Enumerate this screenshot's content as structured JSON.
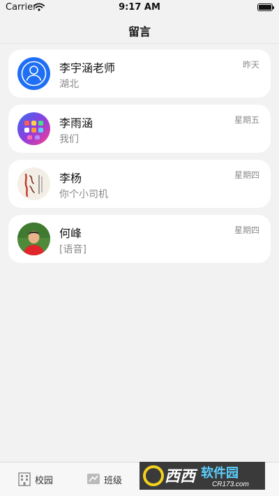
{
  "status": {
    "carrier": "Carrier",
    "time": "9:17 AM"
  },
  "nav": {
    "title": "留言"
  },
  "messages": [
    {
      "name": "李宇涵老师",
      "preview": "湖北",
      "time": "昨天",
      "avatar": "default-user-icon"
    },
    {
      "name": "李雨涵",
      "preview": "我们",
      "time": "星期五",
      "avatar": "phone-homescreen-photo"
    },
    {
      "name": "李杨",
      "preview": "你个小司机",
      "time": "星期四",
      "avatar": "calligraphy-photo"
    },
    {
      "name": "何峰",
      "preview": "[语音]",
      "time": "星期四",
      "avatar": "child-portrait-photo"
    }
  ],
  "tabs": [
    {
      "label": "校园",
      "icon": "building-icon"
    },
    {
      "label": "班级",
      "icon": "class-icon"
    }
  ],
  "watermark": {
    "brand": "西西",
    "text": "软件园",
    "domain": "CR173.com"
  },
  "colors": {
    "accent": "#1e6ff5",
    "card": "#ffffff",
    "background": "#f2f2f2"
  }
}
